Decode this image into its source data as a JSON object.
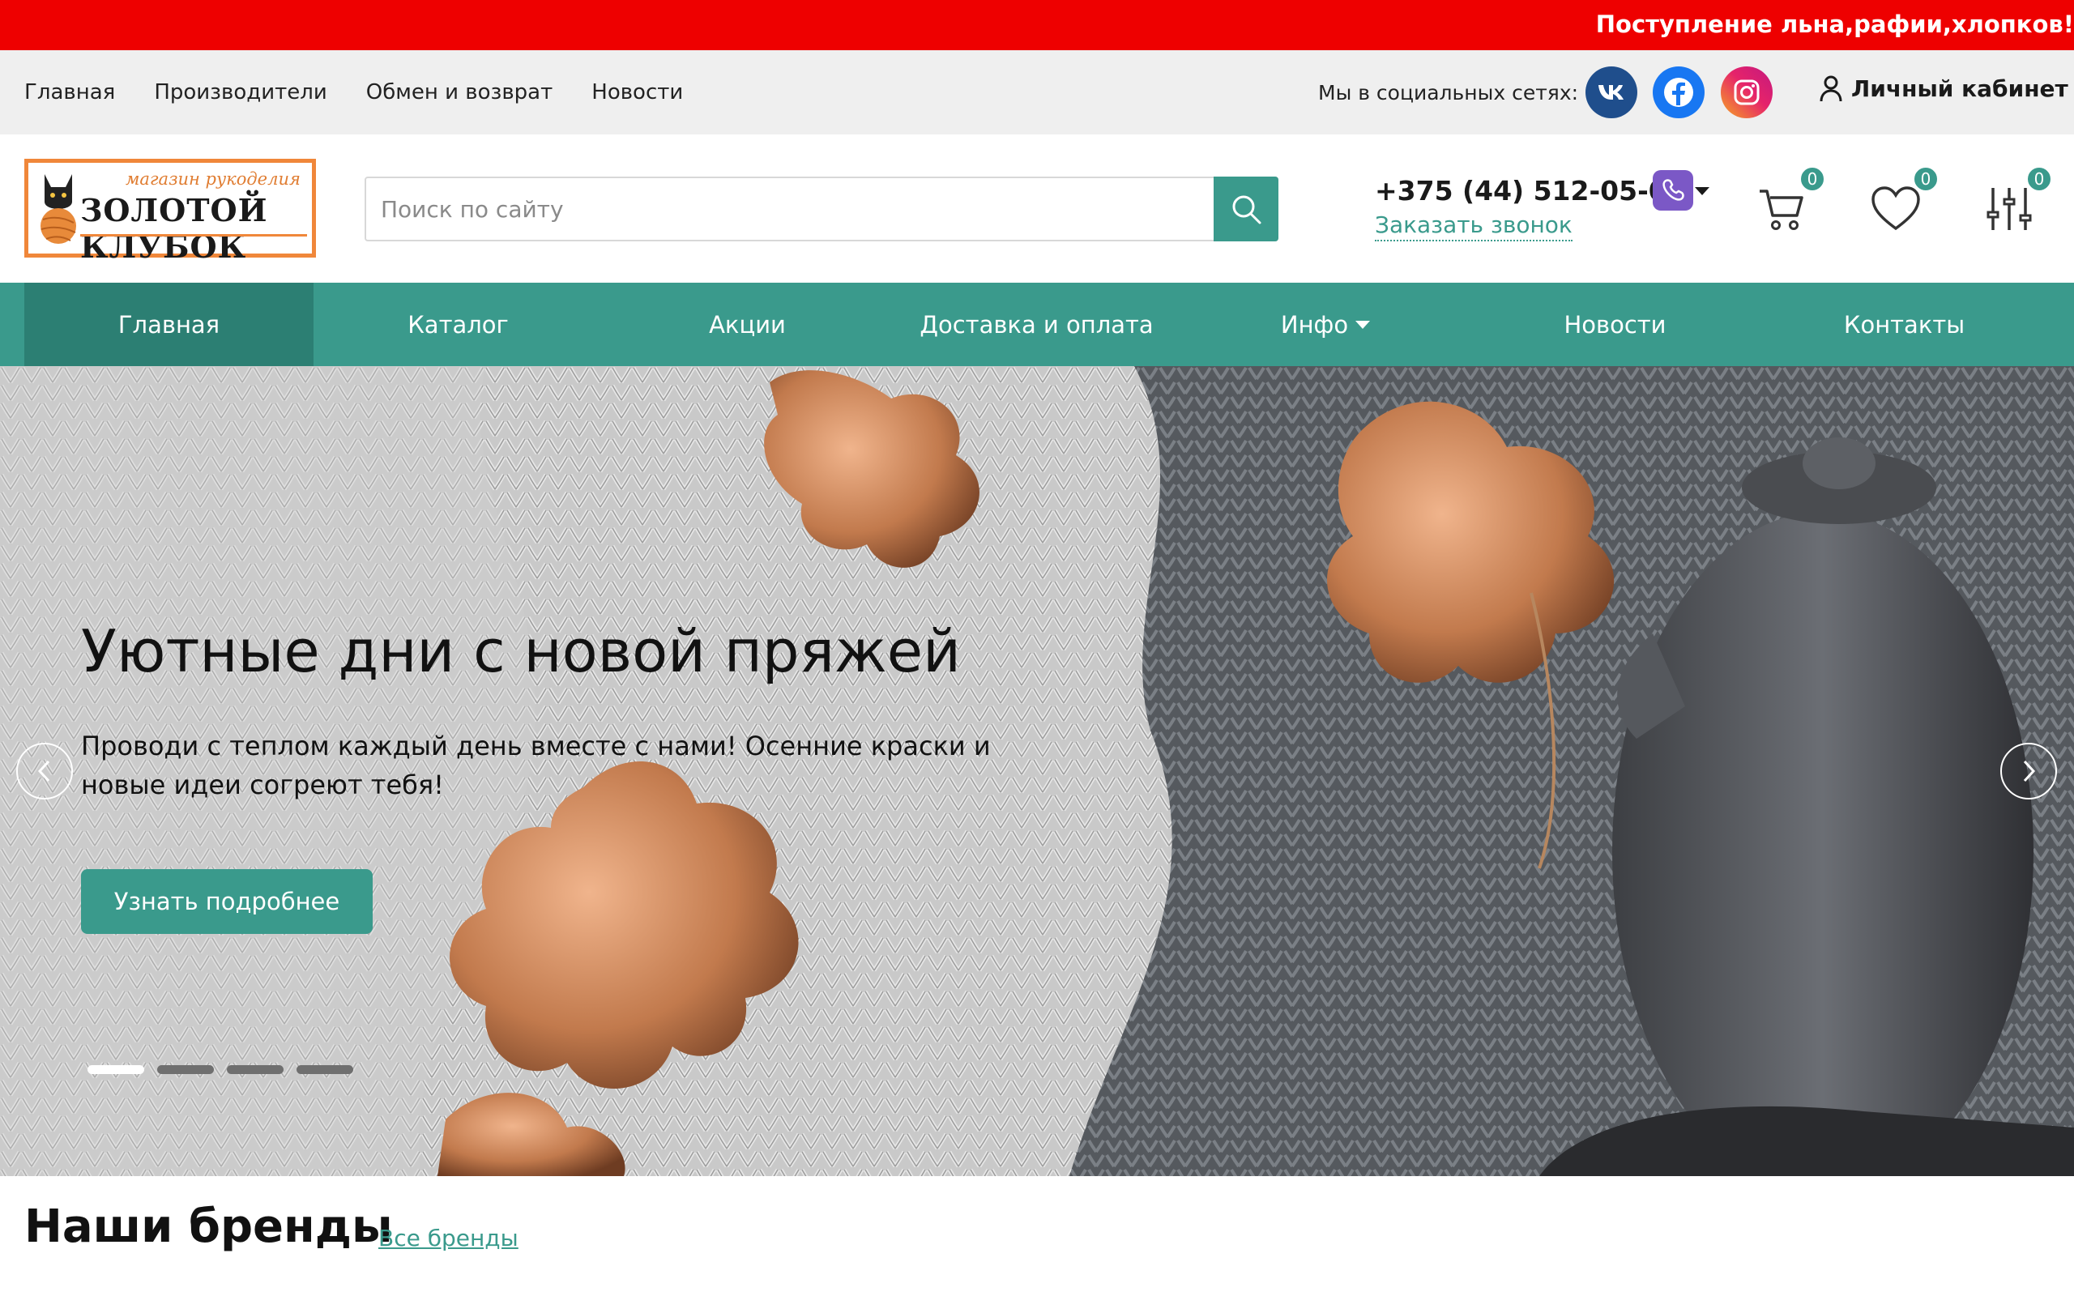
{
  "marquee": {
    "text": "Поступление льна,рафии,хлопков!"
  },
  "topbar": {
    "nav": [
      "Главная",
      "Производители",
      "Обмен и возврат",
      "Новости"
    ],
    "social_label": "Мы в социальных сетях:",
    "social": [
      {
        "name": "vk",
        "icon": "vk-icon",
        "label": "vk"
      },
      {
        "name": "facebook",
        "icon": "facebook-icon",
        "label": "f"
      },
      {
        "name": "instagram",
        "icon": "instagram-icon",
        "label": ""
      }
    ],
    "account_label": "Личный кабинет"
  },
  "header": {
    "logo": {
      "subtitle": "магазин рукоделия",
      "title": "ЗОЛОТОЙ КЛУБОК"
    },
    "search": {
      "placeholder": "Поиск по сайту",
      "value": ""
    },
    "phone": "+375 (44) 512-05-06",
    "callback": "Заказать звонок",
    "counters": {
      "cart": "0",
      "favorites": "0",
      "compare": "0"
    }
  },
  "mainnav": {
    "items": [
      "Главная",
      "Каталог",
      "Акции",
      "Доставка и оплата",
      "Инфо",
      "Новости",
      "Контакты"
    ],
    "active_index": 0
  },
  "hero": {
    "title": "Уютные дни с новой пряжей",
    "text": "Проводи с теплом каждый день вместе с нами! Осенние краски и новые идеи согреют тебя!",
    "button": "Узнать подробнее",
    "slides_count": 4,
    "active_slide": 0
  },
  "brands": {
    "title": "Наши бренды",
    "link": "Все бренды"
  },
  "colors": {
    "accent": "#3a9a8c",
    "marquee": "#ee0000",
    "logo_border": "#f0873a"
  }
}
